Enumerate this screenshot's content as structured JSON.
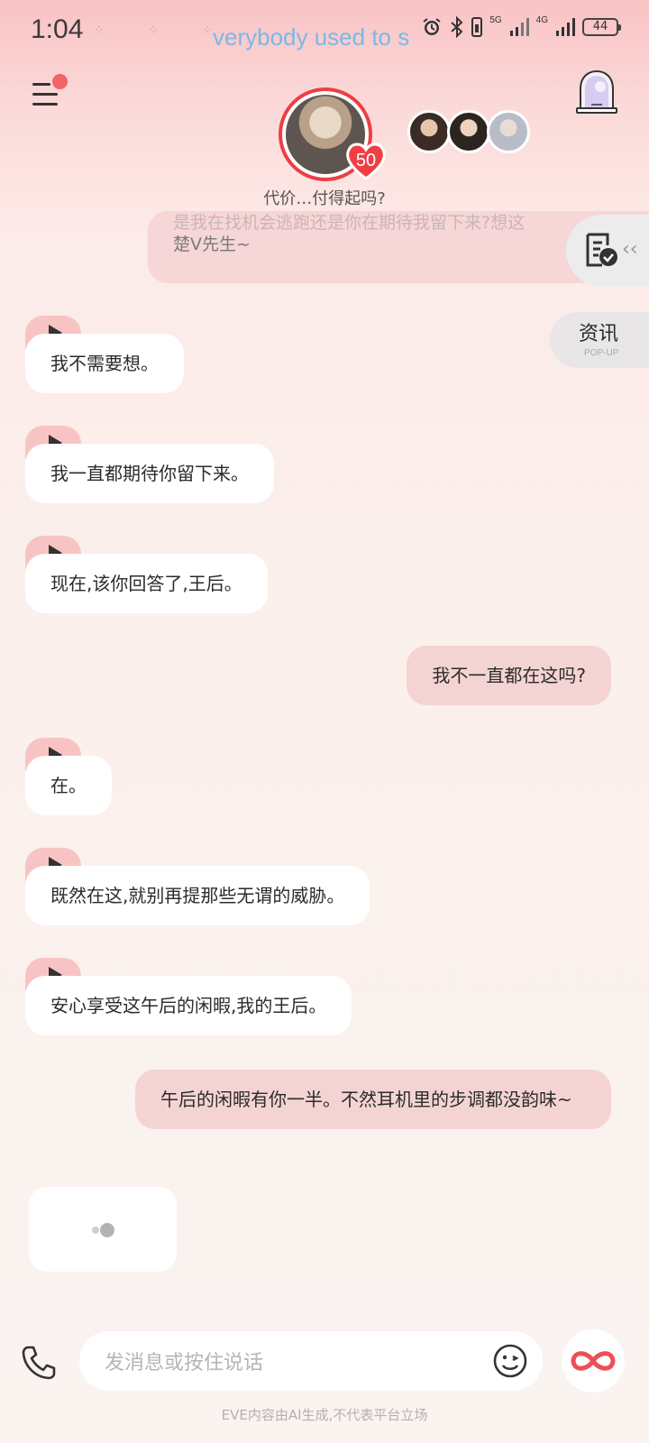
{
  "status_bar": {
    "time": "1:04",
    "notification_dots": "⁘ ⁘ ⁘",
    "ticker": "verybody used to s",
    "net1": "5G",
    "net2": "4G",
    "battery": "44"
  },
  "header": {
    "menu_icon": "menu-icon",
    "avatar_badge": "50",
    "subtitle": "代价…付得起吗?"
  },
  "colors": {
    "accent": "#ee3e43",
    "incoming_bubble": "#ffffff",
    "outgoing_bubble": "#f4d4d3",
    "play_pill": "#f8c4c3"
  },
  "side_panels": {
    "task_icon": "checklist-icon",
    "news_label": "资讯",
    "news_sub": "POP-UP"
  },
  "previous_message": {
    "line1": "是我在找机会逃跑还是你在期待我留下来?想这",
    "line2": "楚V先生~"
  },
  "messages": [
    {
      "from": "ai",
      "text": "我不需要想。"
    },
    {
      "from": "ai",
      "text": "我一直都期待你留下来。"
    },
    {
      "from": "ai",
      "text": "现在,该你回答了,王后。"
    },
    {
      "from": "user",
      "text": "我不一直都在这吗?"
    },
    {
      "from": "ai",
      "text": "在。"
    },
    {
      "from": "ai",
      "text": "既然在这,就别再提那些无谓的威胁。"
    },
    {
      "from": "ai",
      "text": "安心享受这午后的闲暇,我的王后。"
    },
    {
      "from": "user",
      "text": "午后的闲暇有你一半。不然耳机里的步调都没韵味~"
    }
  ],
  "composer": {
    "placeholder": "发消息或按住说话",
    "phone_icon": "phone-icon",
    "emoji_icon": "emoji-icon",
    "infinity_icon": "infinity-icon"
  },
  "footer": "EVE内容由AI生成,不代表平台立场"
}
